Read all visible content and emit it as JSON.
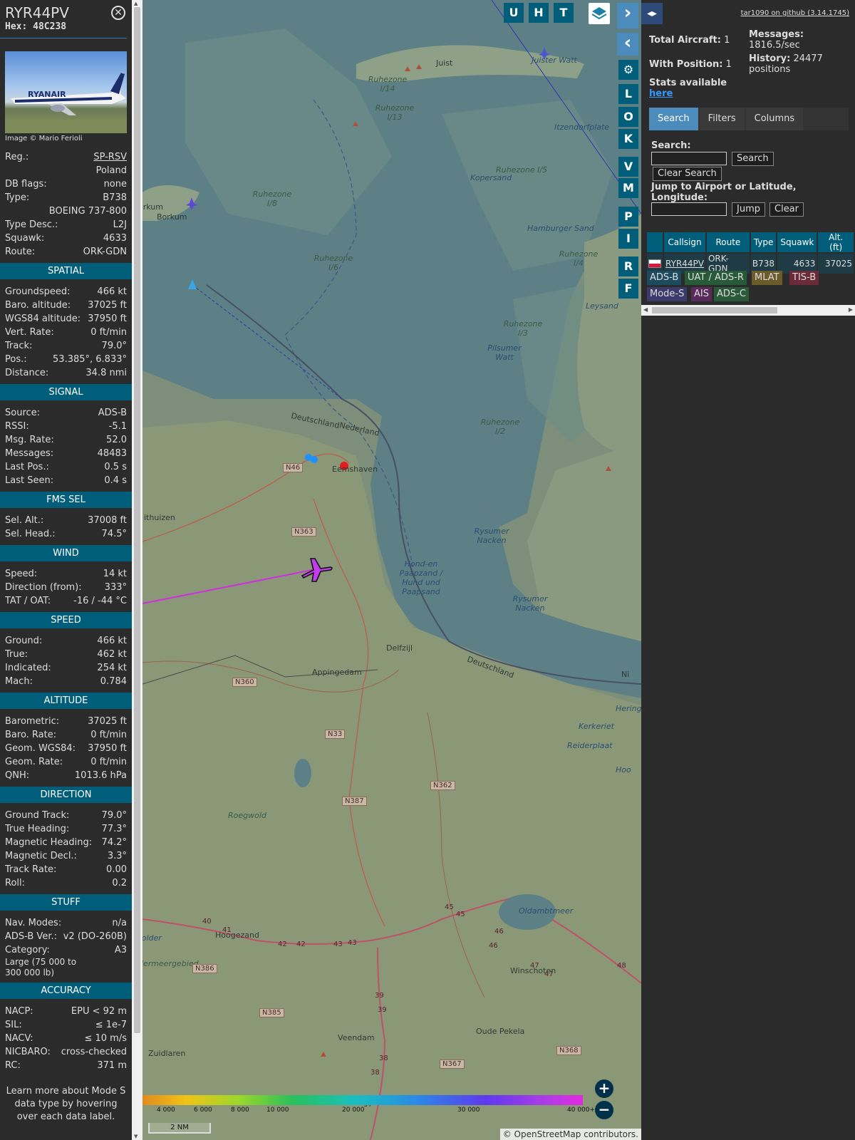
{
  "info": {
    "callsign": "RYR44PV",
    "hex_label": "Hex:",
    "hex": "48C238",
    "photo_credit": "Image © Mario Ferioli",
    "photo_text": "RYANAIR",
    "top_rows": [
      {
        "label": "Reg.:",
        "value": "SP-RSV",
        "link": true
      },
      {
        "label": "",
        "value": "Poland"
      },
      {
        "label": "DB flags:",
        "value": "none"
      },
      {
        "label": "Type:",
        "value": "B738"
      },
      {
        "label": "",
        "value": "BOEING 737-800"
      },
      {
        "label": "Type Desc.:",
        "value": "L2J"
      },
      {
        "label": "Squawk:",
        "value": "4633"
      },
      {
        "label": "Route:",
        "value": "ORK-GDN"
      }
    ],
    "sections": [
      {
        "title": "SPATIAL",
        "rows": [
          {
            "label": "Groundspeed:",
            "value": "466 kt"
          },
          {
            "label": "Baro. altitude:",
            "value": "37025 ft"
          },
          {
            "label": "WGS84 altitude:",
            "value": "37950 ft"
          },
          {
            "label": "Vert. Rate:",
            "value": "0 ft/min"
          },
          {
            "label": "Track:",
            "value": "79.0°"
          },
          {
            "label": "Pos.:",
            "value": "53.385°, 6.833°"
          },
          {
            "label": "Distance:",
            "value": "34.8 nmi"
          }
        ]
      },
      {
        "title": "SIGNAL",
        "rows": [
          {
            "label": "Source:",
            "value": "ADS-B"
          },
          {
            "label": "RSSI:",
            "value": "-5.1"
          },
          {
            "label": "Msg. Rate:",
            "value": "52.0"
          },
          {
            "label": "Messages:",
            "value": "48483"
          },
          {
            "label": "Last Pos.:",
            "value": "0.5 s"
          },
          {
            "label": "Last Seen:",
            "value": "0.4 s"
          }
        ]
      },
      {
        "title": "FMS SEL",
        "rows": [
          {
            "label": "Sel. Alt.:",
            "value": "37008 ft"
          },
          {
            "label": "Sel. Head.:",
            "value": "74.5°"
          }
        ]
      },
      {
        "title": "WIND",
        "rows": [
          {
            "label": "Speed:",
            "value": "14 kt"
          },
          {
            "label": "Direction (from):",
            "value": "333°"
          },
          {
            "label": "TAT / OAT:",
            "value": "-16 / -44 °C"
          }
        ]
      },
      {
        "title": "SPEED",
        "rows": [
          {
            "label": "Ground:",
            "value": "466 kt"
          },
          {
            "label": "True:",
            "value": "462 kt"
          },
          {
            "label": "Indicated:",
            "value": "254 kt"
          },
          {
            "label": "Mach:",
            "value": "0.784"
          }
        ]
      },
      {
        "title": "ALTITUDE",
        "rows": [
          {
            "label": "Barometric:",
            "value": "37025 ft"
          },
          {
            "label": "Baro. Rate:",
            "value": "0 ft/min"
          },
          {
            "label": "Geom. WGS84:",
            "value": "37950 ft"
          },
          {
            "label": "Geom. Rate:",
            "value": "0 ft/min"
          },
          {
            "label": "QNH:",
            "value": "1013.6 hPa"
          }
        ]
      },
      {
        "title": "DIRECTION",
        "rows": [
          {
            "label": "Ground Track:",
            "value": "79.0°"
          },
          {
            "label": "True Heading:",
            "value": "77.3°"
          },
          {
            "label": "Magnetic Heading:",
            "value": "74.2°"
          },
          {
            "label": "Magnetic Decl.:",
            "value": "3.3°"
          },
          {
            "label": "Track Rate:",
            "value": "0.00"
          },
          {
            "label": "Roll:",
            "value": "0.2"
          }
        ]
      },
      {
        "title": "STUFF",
        "rows": [
          {
            "label": "Nav. Modes:",
            "value": "n/a"
          },
          {
            "label": "ADS-B Ver.:",
            "value": "v2 (DO-260B)"
          },
          {
            "label": "Category:",
            "value": "A3"
          }
        ],
        "note": "Large (75 000 to 300 000 lb)"
      },
      {
        "title": "ACCURACY",
        "rows": [
          {
            "label": "NACP:",
            "value": "EPU < 92 m"
          },
          {
            "label": "SIL:",
            "value": "≤ 1e-7"
          },
          {
            "label": "NACV:",
            "value": "≤ 10 m/s"
          },
          {
            "label": "NICBARO:",
            "value": "cross-checked"
          },
          {
            "label": "RC:",
            "value": "371 m"
          }
        ]
      }
    ],
    "learn_more": "Learn more about Mode S data type by hovering over each data label."
  },
  "map": {
    "top_buttons": [
      "U",
      "H",
      "T"
    ],
    "side_buttons": [
      "L",
      "O",
      "K",
      "V",
      "M",
      "P",
      "I",
      "R",
      "F"
    ],
    "place_labels": [
      {
        "text": "Juist",
        "cls": "mlabel"
      },
      {
        "text": "Juister Watt",
        "cls": "mlabel blue"
      },
      {
        "text": "Ruhezone I/14",
        "cls": "mlabel it"
      },
      {
        "text": "Ruhezone I/13",
        "cls": "mlabel it"
      },
      {
        "text": "Itzendorfplate",
        "cls": "mlabel blue"
      },
      {
        "text": "Ruhezone I/5",
        "cls": "mlabel it"
      },
      {
        "text": "Kopersand",
        "cls": "mlabel blue"
      },
      {
        "text": "Borkum",
        "cls": "mlabel"
      },
      {
        "text": "orkum",
        "cls": "mlabel"
      },
      {
        "text": "Ruhezone I/8",
        "cls": "mlabel it"
      },
      {
        "text": "Hamburger Sand",
        "cls": "mlabel blue"
      },
      {
        "text": "Ruhezone I/6",
        "cls": "mlabel it"
      },
      {
        "text": "Ruhezone I/4",
        "cls": "mlabel it"
      },
      {
        "text": "Leysand",
        "cls": "mlabel blue"
      },
      {
        "text": "Ruhezone I/3",
        "cls": "mlabel it"
      },
      {
        "text": "Pilsumer Watt",
        "cls": "mlabel blue"
      },
      {
        "text": "Ruhezone I/2",
        "cls": "mlabel it"
      },
      {
        "text": "Deutschland",
        "cls": "mlabel"
      },
      {
        "text": "Nederland",
        "cls": "mlabel"
      },
      {
        "text": "Eemshaven",
        "cls": "mlabel"
      },
      {
        "text": "ithuizen",
        "cls": "mlabel"
      },
      {
        "text": "Rysumer Nacken",
        "cls": "mlabel blue"
      },
      {
        "text": "Hond-en Paapzand / Hund und Paapsand",
        "cls": "mlabel blue"
      },
      {
        "text": "Rysumer Nacken",
        "cls": "mlabel blue"
      },
      {
        "text": "Delfzijl",
        "cls": "mlabel"
      },
      {
        "text": "Appingedam",
        "cls": "mlabel"
      },
      {
        "text": "Deutschland",
        "cls": "mlabel"
      },
      {
        "text": "Ni",
        "cls": "mlabel"
      },
      {
        "text": "Heringsp",
        "cls": "mlabel blue"
      },
      {
        "text": "Kerkeriet",
        "cls": "mlabel blue"
      },
      {
        "text": "Reiderplaat",
        "cls": "mlabel blue"
      },
      {
        "text": "Hoo",
        "cls": "mlabel blue"
      },
      {
        "text": "Roegwold",
        "cls": "mlabel it"
      },
      {
        "text": "Oldambtmeer",
        "cls": "mlabel blue"
      },
      {
        "text": "Hoogezand",
        "cls": "mlabel"
      },
      {
        "text": "oolder",
        "cls": "mlabel blue"
      },
      {
        "text": "dermeergebied",
        "cls": "mlabel it"
      },
      {
        "text": "Winschoten",
        "cls": "mlabel"
      },
      {
        "text": "Oude Pekela",
        "cls": "mlabel"
      },
      {
        "text": "Veendam",
        "cls": "mlabel"
      },
      {
        "text": "Zuidlaren",
        "cls": "mlabel"
      }
    ],
    "roads": [
      "N46",
      "N363",
      "N360",
      "N33",
      "N387",
      "N362",
      "N386",
      "N385",
      "N367",
      "N368"
    ],
    "motorway_numbers": [
      "40",
      "41",
      "42",
      "42",
      "43",
      "43",
      "45",
      "45",
      "46",
      "46",
      "47",
      "47",
      "48",
      "39",
      "39",
      "38",
      "38",
      "37"
    ],
    "alt_ticks": [
      "4 000",
      "6 000",
      "8 000",
      "10 000",
      "20 000",
      "30 000",
      "40 000+"
    ],
    "scale": "2 NM",
    "attribution_prefix": "©",
    "attribution_link": "OpenStreetMap",
    "attribution_suffix": "contributors."
  },
  "right": {
    "github": "tar1090 on github (3.14.1745)",
    "total_label": "Total Aircraft:",
    "total": "1",
    "withpos_label": "With Position:",
    "withpos": "1",
    "messages_label": "Messages:",
    "messages": "1816.5/sec",
    "history_label": "History:",
    "history": "24477 positions",
    "stats_label": "Stats available",
    "stats_link": "here",
    "tabs": [
      "Search",
      "Filters",
      "Columns"
    ],
    "search_label": "Search:",
    "search_btn": "Search",
    "clear_search": "Clear Search",
    "jump_label": "Jump to Airport or Latitude, Longitude:",
    "jump_btn": "Jump",
    "clear_btn": "Clear",
    "table_headers": [
      "",
      "Callsign",
      "Route",
      "Type",
      "Squawk",
      "Alt. (ft)"
    ],
    "table_rows": [
      {
        "callsign": "RYR44PV",
        "route": "ORK-GDN",
        "type": "B738",
        "squawk": "4633",
        "alt": "37025"
      }
    ],
    "badges": [
      {
        "label": "ADS-B",
        "bg": "#1c4a5f",
        "color": "#ddd"
      },
      {
        "label": "UAT / ADS-R",
        "bg": "#285a3a",
        "color": "#ddd"
      },
      {
        "label": "MLAT",
        "bg": "#6b5a2a",
        "color": "#ddd"
      },
      {
        "label": "TIS-B",
        "bg": "#6b2a3a",
        "color": "#ddd"
      },
      {
        "label": "Mode-S",
        "bg": "#3b3a6b",
        "color": "#ddd"
      },
      {
        "label": "AIS",
        "bg": "#5a2a5a",
        "color": "#ddd"
      },
      {
        "label": "ADS-C",
        "bg": "#2a5a3a",
        "color": "#ddd"
      }
    ]
  }
}
